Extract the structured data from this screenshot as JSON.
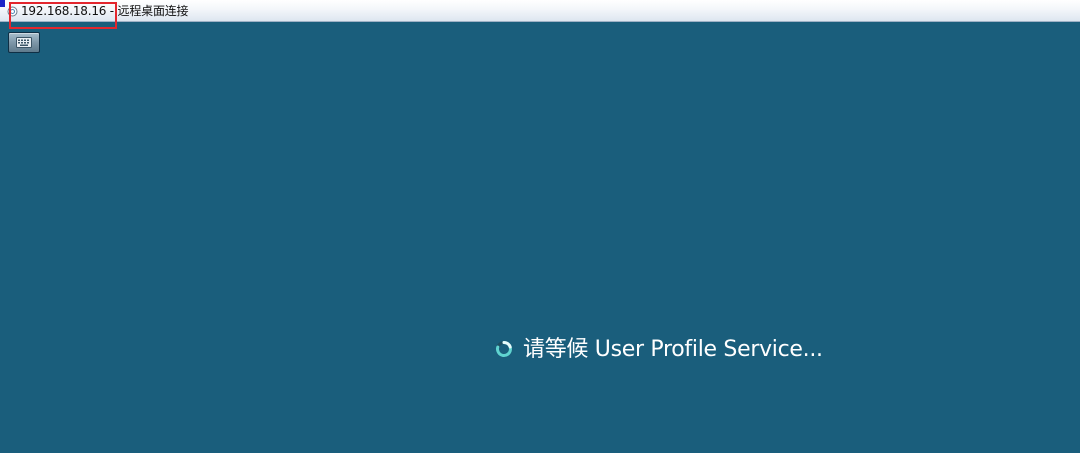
{
  "window": {
    "title": "192.168.18.16 - 远程桌面连接",
    "title_icon": "remote-desktop-icon"
  },
  "toolbar": {
    "keyboard_button_icon": "keyboard-icon"
  },
  "status": {
    "text": "请等候 User Profile Service...",
    "spinner_icon": "loading-spinner-icon"
  },
  "colors": {
    "desktop_background": "#1a5e7c",
    "highlight": "#e3262d",
    "spinner": "#5fd3d0"
  }
}
